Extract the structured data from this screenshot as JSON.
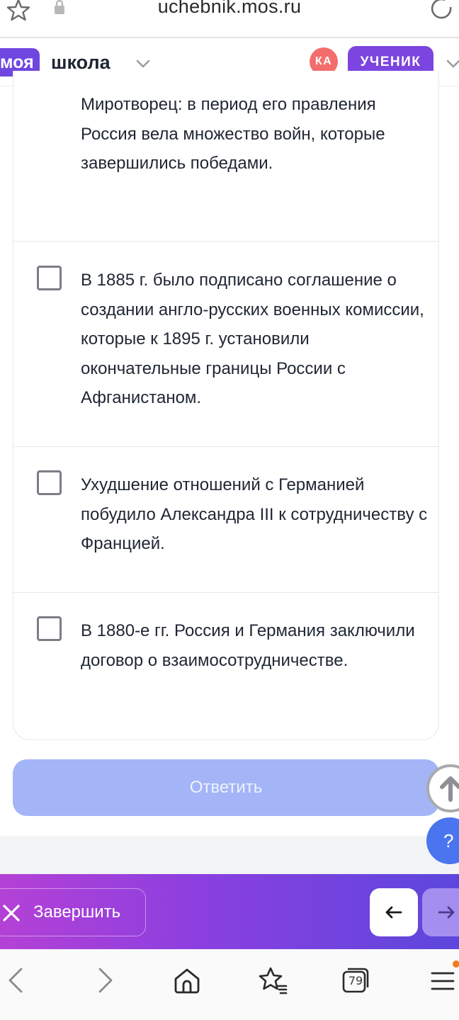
{
  "browser": {
    "url": "uchebnik.mos.ru",
    "icons": [
      "star-outline-icon",
      "lock-icon",
      "reload-icon"
    ]
  },
  "header": {
    "logo_part1": "моя",
    "logo_part2": "школа",
    "avatar_initials": "КА",
    "role_label": "УЧЕНИК",
    "colors": {
      "brand": "#6f47e0",
      "avatar": "#f46d6d",
      "role": "#7c45df"
    }
  },
  "options": [
    {
      "text": "Миротворец: в период его правления Россия вела множество войн, которые завершились победами.",
      "checked": false
    },
    {
      "text": "В 1885 г. было подписано соглашение о создании англо-русских военных комиссии, которые к 1895 г. установили окончательные границы России с Афганистаном.",
      "checked": false
    },
    {
      "text": "Ухудшение отношений с Германией побудило Александра III к сотрудничеству с Францией.",
      "checked": false
    },
    {
      "text": "В 1880-е гг. Россия и Германия заключили договор о взаимосотрудничестве.",
      "checked": false
    }
  ],
  "answer_button": {
    "label": "Ответить",
    "enabled": false
  },
  "help_button": {
    "label": "?"
  },
  "finish_bar": {
    "finish_label": "Завершить",
    "prev_icon": "arrow-left-icon",
    "next_icon": "arrow-right-icon"
  },
  "browser_nav": {
    "tab_count": "79",
    "icons": [
      "back-icon",
      "forward-icon",
      "home-icon",
      "bookmarks-icon",
      "tabs-icon",
      "menu-icon"
    ]
  }
}
